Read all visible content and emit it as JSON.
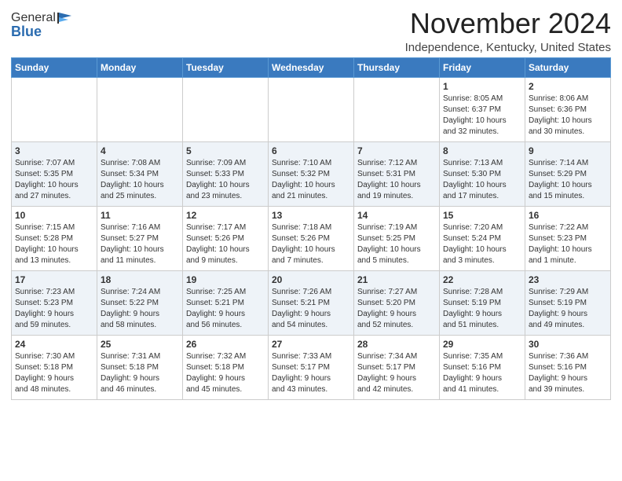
{
  "header": {
    "logo_general": "General",
    "logo_blue": "Blue",
    "month_title": "November 2024",
    "location": "Independence, Kentucky, United States"
  },
  "columns": [
    "Sunday",
    "Monday",
    "Tuesday",
    "Wednesday",
    "Thursday",
    "Friday",
    "Saturday"
  ],
  "weeks": [
    [
      {
        "day": "",
        "info": ""
      },
      {
        "day": "",
        "info": ""
      },
      {
        "day": "",
        "info": ""
      },
      {
        "day": "",
        "info": ""
      },
      {
        "day": "",
        "info": ""
      },
      {
        "day": "1",
        "info": "Sunrise: 8:05 AM\nSunset: 6:37 PM\nDaylight: 10 hours\nand 32 minutes."
      },
      {
        "day": "2",
        "info": "Sunrise: 8:06 AM\nSunset: 6:36 PM\nDaylight: 10 hours\nand 30 minutes."
      }
    ],
    [
      {
        "day": "3",
        "info": "Sunrise: 7:07 AM\nSunset: 5:35 PM\nDaylight: 10 hours\nand 27 minutes."
      },
      {
        "day": "4",
        "info": "Sunrise: 7:08 AM\nSunset: 5:34 PM\nDaylight: 10 hours\nand 25 minutes."
      },
      {
        "day": "5",
        "info": "Sunrise: 7:09 AM\nSunset: 5:33 PM\nDaylight: 10 hours\nand 23 minutes."
      },
      {
        "day": "6",
        "info": "Sunrise: 7:10 AM\nSunset: 5:32 PM\nDaylight: 10 hours\nand 21 minutes."
      },
      {
        "day": "7",
        "info": "Sunrise: 7:12 AM\nSunset: 5:31 PM\nDaylight: 10 hours\nand 19 minutes."
      },
      {
        "day": "8",
        "info": "Sunrise: 7:13 AM\nSunset: 5:30 PM\nDaylight: 10 hours\nand 17 minutes."
      },
      {
        "day": "9",
        "info": "Sunrise: 7:14 AM\nSunset: 5:29 PM\nDaylight: 10 hours\nand 15 minutes."
      }
    ],
    [
      {
        "day": "10",
        "info": "Sunrise: 7:15 AM\nSunset: 5:28 PM\nDaylight: 10 hours\nand 13 minutes."
      },
      {
        "day": "11",
        "info": "Sunrise: 7:16 AM\nSunset: 5:27 PM\nDaylight: 10 hours\nand 11 minutes."
      },
      {
        "day": "12",
        "info": "Sunrise: 7:17 AM\nSunset: 5:26 PM\nDaylight: 10 hours\nand 9 minutes."
      },
      {
        "day": "13",
        "info": "Sunrise: 7:18 AM\nSunset: 5:26 PM\nDaylight: 10 hours\nand 7 minutes."
      },
      {
        "day": "14",
        "info": "Sunrise: 7:19 AM\nSunset: 5:25 PM\nDaylight: 10 hours\nand 5 minutes."
      },
      {
        "day": "15",
        "info": "Sunrise: 7:20 AM\nSunset: 5:24 PM\nDaylight: 10 hours\nand 3 minutes."
      },
      {
        "day": "16",
        "info": "Sunrise: 7:22 AM\nSunset: 5:23 PM\nDaylight: 10 hours\nand 1 minute."
      }
    ],
    [
      {
        "day": "17",
        "info": "Sunrise: 7:23 AM\nSunset: 5:23 PM\nDaylight: 9 hours\nand 59 minutes."
      },
      {
        "day": "18",
        "info": "Sunrise: 7:24 AM\nSunset: 5:22 PM\nDaylight: 9 hours\nand 58 minutes."
      },
      {
        "day": "19",
        "info": "Sunrise: 7:25 AM\nSunset: 5:21 PM\nDaylight: 9 hours\nand 56 minutes."
      },
      {
        "day": "20",
        "info": "Sunrise: 7:26 AM\nSunset: 5:21 PM\nDaylight: 9 hours\nand 54 minutes."
      },
      {
        "day": "21",
        "info": "Sunrise: 7:27 AM\nSunset: 5:20 PM\nDaylight: 9 hours\nand 52 minutes."
      },
      {
        "day": "22",
        "info": "Sunrise: 7:28 AM\nSunset: 5:19 PM\nDaylight: 9 hours\nand 51 minutes."
      },
      {
        "day": "23",
        "info": "Sunrise: 7:29 AM\nSunset: 5:19 PM\nDaylight: 9 hours\nand 49 minutes."
      }
    ],
    [
      {
        "day": "24",
        "info": "Sunrise: 7:30 AM\nSunset: 5:18 PM\nDaylight: 9 hours\nand 48 minutes."
      },
      {
        "day": "25",
        "info": "Sunrise: 7:31 AM\nSunset: 5:18 PM\nDaylight: 9 hours\nand 46 minutes."
      },
      {
        "day": "26",
        "info": "Sunrise: 7:32 AM\nSunset: 5:18 PM\nDaylight: 9 hours\nand 45 minutes."
      },
      {
        "day": "27",
        "info": "Sunrise: 7:33 AM\nSunset: 5:17 PM\nDaylight: 9 hours\nand 43 minutes."
      },
      {
        "day": "28",
        "info": "Sunrise: 7:34 AM\nSunset: 5:17 PM\nDaylight: 9 hours\nand 42 minutes."
      },
      {
        "day": "29",
        "info": "Sunrise: 7:35 AM\nSunset: 5:16 PM\nDaylight: 9 hours\nand 41 minutes."
      },
      {
        "day": "30",
        "info": "Sunrise: 7:36 AM\nSunset: 5:16 PM\nDaylight: 9 hours\nand 39 minutes."
      }
    ]
  ]
}
